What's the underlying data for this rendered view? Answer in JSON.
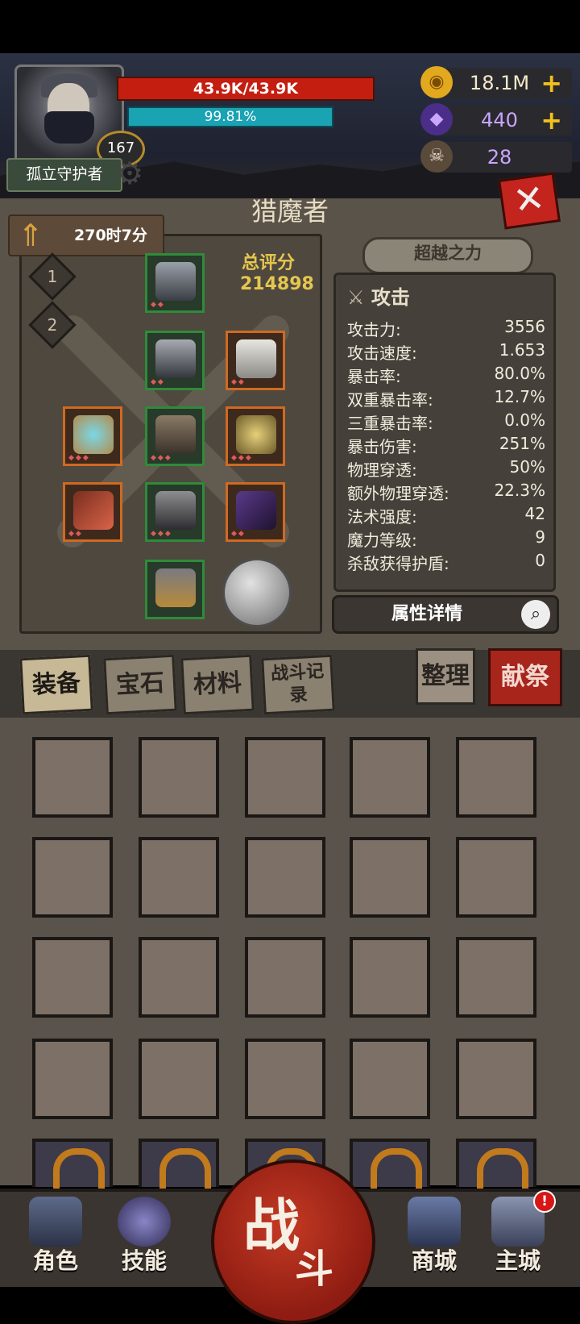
{
  "player": {
    "title": "孤立守护者",
    "level": "167",
    "hp": "43.9K/43.9K",
    "mp": "99.81%"
  },
  "resources": {
    "gold": "18.1M",
    "gems": "440",
    "horns": "28"
  },
  "panel": {
    "title": "猎魔者",
    "timer": "270时7分",
    "ranks": [
      "1",
      "2"
    ],
    "score_label": "总评分",
    "score_value": "214898",
    "transcend_label": "超越之力",
    "details_label": "属性详情"
  },
  "stats": {
    "section": "攻击",
    "rows": [
      {
        "label": "攻击力:",
        "value": "3556"
      },
      {
        "label": "攻击速度:",
        "value": "1.653"
      },
      {
        "label": "暴击率:",
        "value": "80.0%"
      },
      {
        "label": "双重暴击率:",
        "value": "12.7%"
      },
      {
        "label": "三重暴击率:",
        "value": "0.0%"
      },
      {
        "label": "暴击伤害:",
        "value": "251%"
      },
      {
        "label": "物理穿透:",
        "value": "50%"
      },
      {
        "label": "额外物理穿透:",
        "value": "22.3%"
      },
      {
        "label": "法术强度:",
        "value": "42"
      },
      {
        "label": "魔力等级:",
        "value": "9"
      },
      {
        "label": "杀敌获得护盾:",
        "value": "0"
      }
    ]
  },
  "tabs": {
    "equipment": "装备",
    "gems": "宝石",
    "materials": "材料",
    "battle_log": "战斗记录",
    "sort": "整理",
    "sacrifice": "献祭"
  },
  "nav": {
    "character": "角色",
    "skills": "技能",
    "battle_1": "战",
    "battle_2": "斗",
    "shop": "商城",
    "main_city": "主城",
    "alert": "!"
  },
  "colors": {
    "hp": "#c31e10",
    "mp": "#1aa3b3",
    "gold": "#e6c64e",
    "rare_border": "#2f8b3a",
    "epic_border": "#cf6a21"
  }
}
